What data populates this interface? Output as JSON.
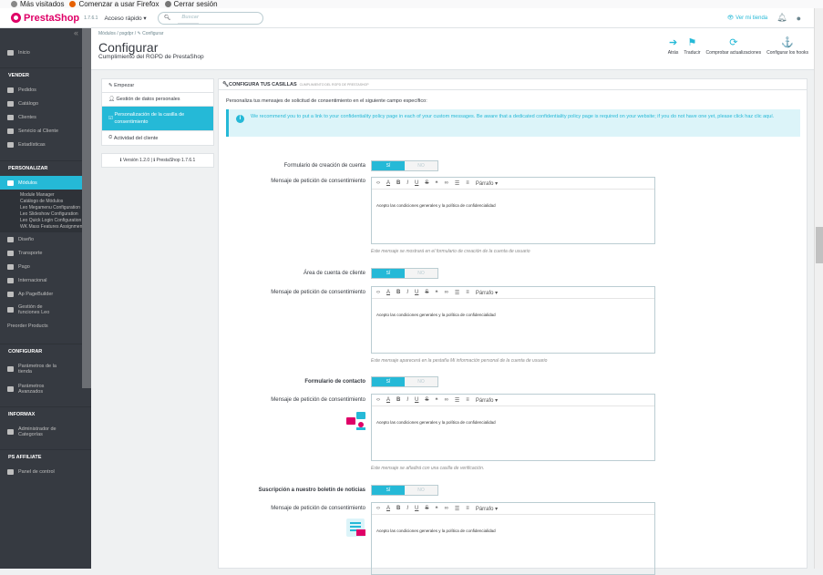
{
  "bookmarks": [
    "Más visitados",
    "Comenzar a usar Firefox",
    "Cerrar sesión"
  ],
  "topbar": {
    "brand": "PrestaShop",
    "version": "1.7.6.1",
    "quick_access": "Acceso rápido ▾",
    "search_placeholder": "Buscar",
    "view_store": "Ver mi tienda"
  },
  "sidebar": {
    "home": "Inicio",
    "sec_sell": "VENDER",
    "sell_items": [
      "Pedidos",
      "Catálogo",
      "Clientes",
      "Servicio al Cliente",
      "Estadísticas"
    ],
    "sec_custom": "PERSONALIZAR",
    "modules": "Módulos",
    "module_subs": [
      "Module Manager",
      "Catálogo de Módulos",
      "Leo Megamenu Configuration",
      "Leo Slideshow Configuration",
      "Leo Quick Login Configuration",
      "WK Mass Features Assignment"
    ],
    "custom_items": [
      "Diseño",
      "Transporte",
      "Pago",
      "Internacional",
      "Ap PageBuilder",
      "Gestión de funciones Leo"
    ],
    "preorder": "Preorder Products",
    "sec_config": "CONFIGURAR",
    "config_items": [
      "Parámetros de la tienda",
      "Parámetros Avanzados"
    ],
    "sec_informax": "INFORMAX",
    "informax_items": [
      "Administrador de Categorías"
    ],
    "sec_affiliate": "PS AFFILIATE",
    "affiliate_items": [
      "Panel de control"
    ]
  },
  "header": {
    "breadcrumb": "Módulos / psgdpr / ✎ Configurar",
    "title": "Configurar",
    "subtitle": "Cumplimiento del RGPD de PrestaShop",
    "tools": [
      "Atrás",
      "Traducir",
      "Comprobar actualizaciones",
      "Configurar los hooks"
    ]
  },
  "tabs": [
    "Empezar",
    "Gestión de datos personales",
    "Personalización de la casilla de consentimiento",
    "Actividad del cliente"
  ],
  "version_box": "ℹ Versión 1.2.0 | ℹ PrestaShop 1.7.6.1",
  "panel": {
    "heading": "CONFIGURA TUS CASILLAS",
    "heading_small": "CUMPLIMIENTO DEL RGPD DE PRESTASHOP",
    "intro": "Personaliza tus mensajes de solicitud de consentimiento en el siguiente campo específico:",
    "info": "We recommend you to put a link to your confidentiality policy page in each of your custom messages. Be aware that a dedicated confidentiality policy page is required on your website; if you do not have one yet, please click haz clic aquí."
  },
  "switch": {
    "yes": "SÍ",
    "no": "NO"
  },
  "toolbar": {
    "paragraph": "Párrafo ▾"
  },
  "consent_label": "Mensaje de petición de consentimiento",
  "editor_text": "Acepto las condiciones generales y la política de confidencialidad",
  "sections": [
    {
      "label": "Formulario de creación de cuenta",
      "help": "Este mensaje se mostrará en el formulario de creación de la cuenta de usuario"
    },
    {
      "label": "Área de cuenta de cliente",
      "help": "Este mensaje aparecerá en la pestaña Mi información personal de la cuenta de usuario"
    },
    {
      "label": "Formulario de contacto",
      "help": "Este mensaje se añadirá con una casilla de verificación."
    },
    {
      "label": "Suscripción a nuestro boletín de noticias",
      "help": ""
    }
  ]
}
